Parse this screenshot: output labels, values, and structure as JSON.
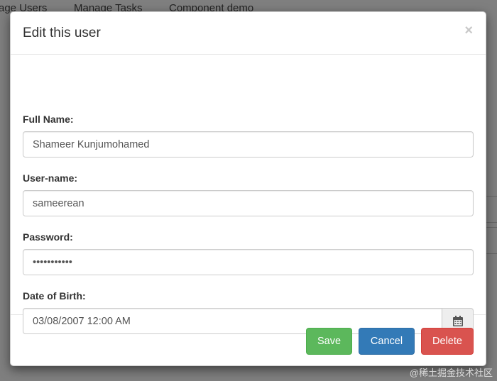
{
  "background": {
    "nav": [
      "age Users",
      "Manage Tasks",
      "Component demo"
    ]
  },
  "modal": {
    "title": "Edit this user",
    "close_glyph": "×",
    "fields": {
      "full_name": {
        "label": "Full Name:",
        "value": "Shameer Kunjumohamed"
      },
      "username": {
        "label": "User-name:",
        "value": "sameerean"
      },
      "password": {
        "label": "Password:",
        "value": "sameerean12"
      },
      "dob": {
        "label": "Date of Birth:",
        "value": "03/08/2007 12:00 AM"
      }
    },
    "buttons": {
      "save": "Save",
      "cancel": "Cancel",
      "delete": "Delete"
    }
  },
  "watermark": "@稀土掘金技术社区",
  "colors": {
    "save": "#5cb85c",
    "cancel": "#337ab7",
    "delete": "#d9534f"
  },
  "icons": {
    "close": "close-icon",
    "calendar": "calendar-icon"
  }
}
